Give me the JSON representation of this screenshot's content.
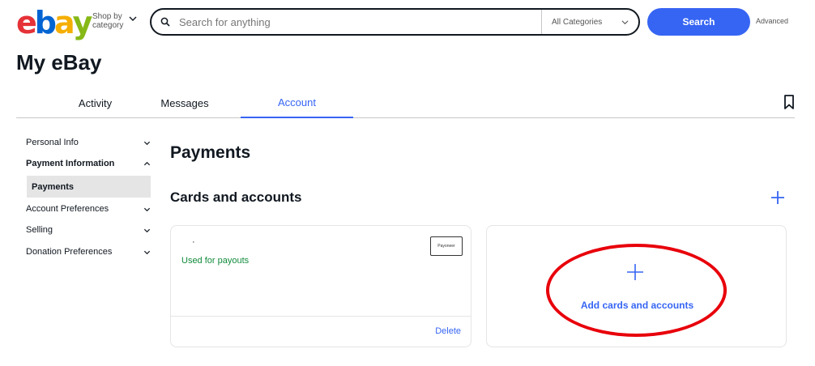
{
  "header": {
    "logo_letters": [
      "e",
      "b",
      "a",
      "y"
    ],
    "logo_colors": [
      "#e53238",
      "#0064d2",
      "#f5af02",
      "#86b817"
    ],
    "shop_by_category": "Shop by category",
    "search_placeholder": "Search for anything",
    "category_selected": "All Categories",
    "search_button": "Search",
    "advanced_link": "Advanced"
  },
  "page_title": "My eBay",
  "tabs": [
    {
      "label": "Activity",
      "active": false
    },
    {
      "label": "Messages",
      "active": false
    },
    {
      "label": "Account",
      "active": true
    }
  ],
  "sidebar": {
    "items": [
      {
        "label": "Personal Info",
        "expanded": false
      },
      {
        "label": "Payment Information",
        "expanded": true
      },
      {
        "label": "Account Preferences",
        "expanded": false
      },
      {
        "label": "Selling",
        "expanded": false
      },
      {
        "label": "Donation Preferences",
        "expanded": false
      }
    ],
    "subitem_selected": "Payments"
  },
  "main": {
    "heading": "Payments",
    "subheading": "Cards and accounts",
    "card": {
      "masked_text": "·",
      "status": "Used for payouts",
      "brand": "Payoneer",
      "delete_label": "Delete"
    },
    "add_card_label": "Add cards and accounts"
  },
  "colors": {
    "accent": "#3665f3",
    "success": "#118a3b",
    "annotation": "#e8000b"
  }
}
